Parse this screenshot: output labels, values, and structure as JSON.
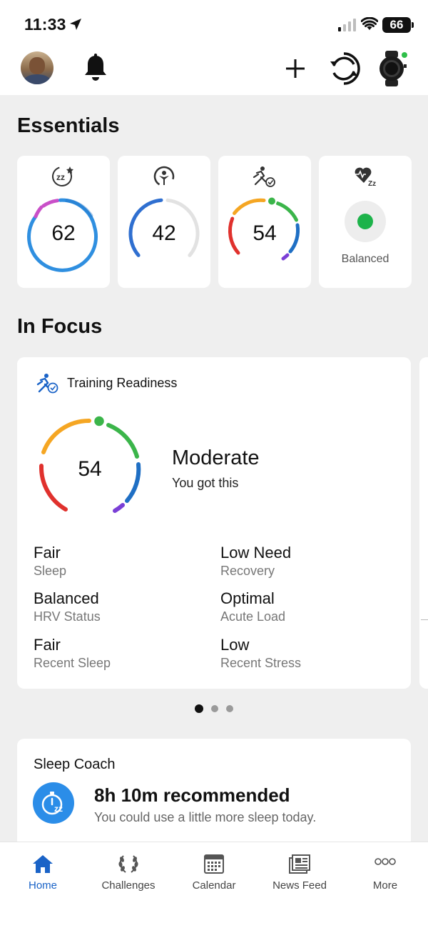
{
  "status_bar": {
    "time": "11:33",
    "battery": "66"
  },
  "header": {
    "icons": [
      "avatar",
      "bell-icon",
      "plus-icon",
      "sync-icon",
      "watch-icon"
    ],
    "device_status_color": "#2fbf4a"
  },
  "essentials": {
    "title": "Essentials",
    "cards": [
      {
        "icon": "sleep-score-icon",
        "value": "62"
      },
      {
        "icon": "body-battery-icon",
        "value": "42"
      },
      {
        "icon": "training-readiness-icon",
        "value": "54"
      },
      {
        "icon": "hrv-status-icon",
        "label": "Balanced",
        "status_color": "#1db34a"
      }
    ]
  },
  "in_focus": {
    "title": "In Focus",
    "card": {
      "title": "Training Readiness",
      "score": "54",
      "status": "Moderate",
      "subtitle": "You got this",
      "metrics": [
        {
          "value": "Fair",
          "label": "Sleep"
        },
        {
          "value": "Low Need",
          "label": "Recovery"
        },
        {
          "value": "Balanced",
          "label": "HRV Status"
        },
        {
          "value": "Optimal",
          "label": "Acute Load"
        },
        {
          "value": "Fair",
          "label": "Recent Sleep"
        },
        {
          "value": "Low",
          "label": "Recent Stress"
        }
      ]
    },
    "pager": {
      "count": 3,
      "active": 1
    }
  },
  "sleep_coach": {
    "title": "Sleep Coach",
    "headline": "8h 10m recommended",
    "subtitle": "You could use a little more sleep today."
  },
  "bottom_nav": {
    "items": [
      {
        "label": "Home",
        "icon": "home-icon",
        "active": true
      },
      {
        "label": "Challenges",
        "icon": "laurel-icon",
        "active": false
      },
      {
        "label": "Calendar",
        "icon": "calendar-icon",
        "active": false
      },
      {
        "label": "News Feed",
        "icon": "news-feed-icon",
        "active": false
      },
      {
        "label": "More",
        "icon": "more-icon",
        "active": false
      }
    ]
  },
  "colors": {
    "accent": "#1a63c7",
    "ring_blue": "#2f8fe0",
    "ring_magenta": "#c94fc8",
    "readiness_orange": "#f5a623",
    "readiness_green": "#3bb54a",
    "readiness_red": "#e0312d",
    "readiness_purple": "#7a3fd6"
  }
}
